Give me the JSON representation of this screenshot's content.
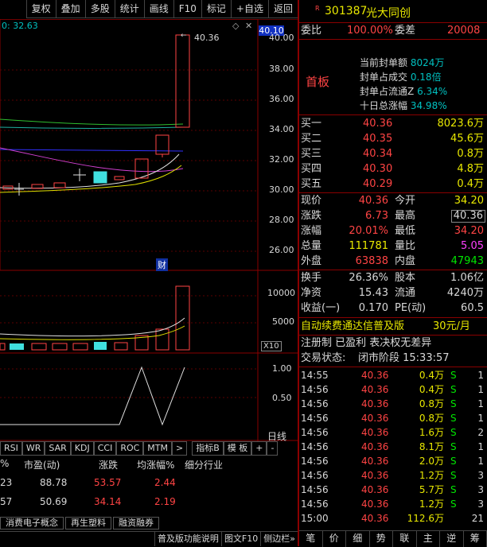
{
  "toolbar": {
    "buttons": [
      "复权",
      "叠加",
      "多股",
      "统计",
      "画线",
      "F10",
      "标记",
      "+自选",
      "返回"
    ]
  },
  "chart": {
    "price_readout": "0: 32.63",
    "current_price_tag": "40.10",
    "high_label": "40.36",
    "y_ticks": [
      "40.00",
      "38.00",
      "36.00",
      "34.00",
      "32.00",
      "30.00",
      "28.00",
      "26.00"
    ],
    "vol_ticks": [
      "10000",
      "5000"
    ],
    "vol_unit": "X10",
    "ind_ticks": [
      "1.00",
      "0.50"
    ],
    "fin_badge": "财",
    "period_label": "日线",
    "indicator_tabs": [
      "RSI",
      "WR",
      "SAR",
      "KDJ",
      "CCI",
      "ROC",
      "MTM",
      ">"
    ],
    "right_tabs": [
      "指标B",
      "模 板",
      "+",
      "-"
    ]
  },
  "table": {
    "headers": [
      "%",
      "市盈(动)",
      "涨跌",
      "均涨幅%",
      "细分行业"
    ],
    "rows": [
      [
        "23",
        "88.78",
        "53.57",
        "2.44",
        ""
      ],
      [
        "57",
        "50.69",
        "34.14",
        "2.19",
        ""
      ]
    ],
    "sector_tabs": [
      "消费电子概念",
      "再生塑料",
      "融资融券"
    ]
  },
  "status_bar": {
    "items": [
      "普及版功能说明",
      "图文F10",
      "侧边栏»"
    ]
  },
  "quote": {
    "badge": "R",
    "code": "301387",
    "name": "光大同创",
    "weibi_label": "委比",
    "weibi_value": "100.00%",
    "weicha_label": "委差",
    "weicha_value": "20008",
    "board_label": "首板",
    "board_info": [
      {
        "label": "当前封单额",
        "value": "8024万"
      },
      {
        "label": "封单占成交",
        "value": "0.18倍"
      },
      {
        "label": "封单占流通Z",
        "value": "6.34%"
      },
      {
        "label": "十日总涨幅",
        "value": "34.98%"
      }
    ],
    "bids": [
      {
        "label": "买一",
        "price": "40.36",
        "vol": "8023.6万"
      },
      {
        "label": "买二",
        "price": "40.35",
        "vol": "45.6万"
      },
      {
        "label": "买三",
        "price": "40.34",
        "vol": "0.8万"
      },
      {
        "label": "买四",
        "price": "40.30",
        "vol": "4.8万"
      },
      {
        "label": "买五",
        "price": "40.29",
        "vol": "0.4万"
      }
    ],
    "stats": [
      {
        "l1": "现价",
        "v1": "40.36",
        "l2": "今开",
        "v2": "34.20"
      },
      {
        "l1": "涨跌",
        "v1": "6.73",
        "l2": "最高",
        "v2": "40.36"
      },
      {
        "l1": "涨幅",
        "v1": "20.01%",
        "l2": "最低",
        "v2": "34.20"
      },
      {
        "l1": "总量",
        "v1": "111781",
        "l2": "量比",
        "v2": "5.05"
      },
      {
        "l1": "外盘",
        "v1": "63838",
        "l2": "内盘",
        "v2": "47943"
      }
    ],
    "stats2": [
      {
        "l1": "换手",
        "v1": "26.36%",
        "l2": "股本",
        "v2": "1.06亿"
      },
      {
        "l1": "净资",
        "v1": "15.43",
        "l2": "流通",
        "v2": "4240万"
      },
      {
        "l1": "收益(一)",
        "v1": "0.170",
        "l2": "PE(动)",
        "v2": "60.5"
      }
    ],
    "promo": "自动续费通达信普及版",
    "promo_price": "30元/月",
    "reg": "注册制 已盈利 表决权无差异",
    "trade_state_label": "交易状态:",
    "trade_state_value": "闭市阶段 15:33:57",
    "ticks": [
      [
        "14:55",
        "40.36",
        "0.4万",
        "S",
        "1"
      ],
      [
        "14:56",
        "40.36",
        "0.4万",
        "S",
        "1"
      ],
      [
        "14:56",
        "40.36",
        "0.8万",
        "S",
        "1"
      ],
      [
        "14:56",
        "40.36",
        "0.8万",
        "S",
        "1"
      ],
      [
        "14:56",
        "40.36",
        "1.6万",
        "S",
        "2"
      ],
      [
        "14:56",
        "40.36",
        "8.1万",
        "S",
        "1"
      ],
      [
        "14:56",
        "40.36",
        "2.0万",
        "S",
        "1"
      ],
      [
        "14:56",
        "40.36",
        "1.2万",
        "S",
        "3"
      ],
      [
        "14:56",
        "40.36",
        "5.7万",
        "S",
        "3"
      ],
      [
        "14:56",
        "40.36",
        "1.2万",
        "S",
        "3"
      ],
      [
        "15:00",
        "40.36",
        "112.6万",
        "",
        "21"
      ]
    ],
    "bottom_tabs": [
      "笔",
      "价",
      "细",
      "势",
      "联",
      "主",
      "逆",
      "筹"
    ]
  }
}
